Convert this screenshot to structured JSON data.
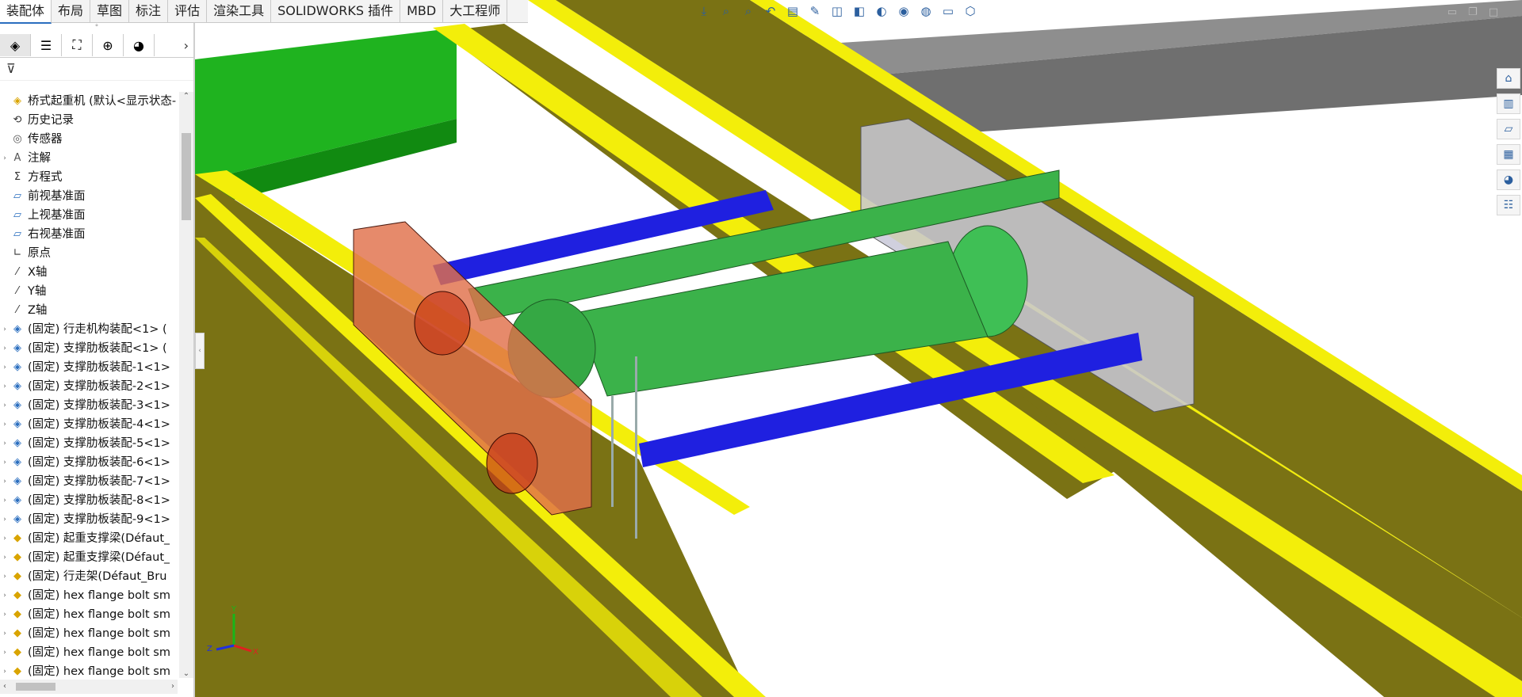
{
  "ribbon": {
    "tabs": [
      {
        "label": "装配体",
        "active": true
      },
      {
        "label": "布局"
      },
      {
        "label": "草图"
      },
      {
        "label": "标注"
      },
      {
        "label": "评估"
      },
      {
        "label": "渲染工具"
      },
      {
        "label": "SOLIDWORKS 插件"
      },
      {
        "label": "MBD"
      },
      {
        "label": "大工程师"
      }
    ]
  },
  "heads_up_toolbar": [
    "view-orientation-icon",
    "zoom-to-fit-icon",
    "zoom-area-icon",
    "previous-view-icon",
    "section-view-icon",
    "dynamic-annotation-icon",
    "view-selector-icon",
    "display-style-icon",
    "hide-show-icon",
    "appearance-icon",
    "scene-icon",
    "view-settings-icon",
    "3d-box-icon"
  ],
  "feature_manager": {
    "panel_tabs": [
      "featuremanager-icon",
      "propertymanager-icon",
      "configurationmanager-icon",
      "dimxpert-icon",
      "displaymanager-icon"
    ],
    "tree": [
      {
        "label": "桥式起重机  (默认<显示状态-",
        "icon": "assembly-root-icon",
        "expand": ""
      },
      {
        "label": "历史记录",
        "icon": "history-icon",
        "expand": ""
      },
      {
        "label": "传感器",
        "icon": "sensor-icon",
        "expand": ""
      },
      {
        "label": "注解",
        "icon": "annotation-icon",
        "expand": "›"
      },
      {
        "label": "方程式",
        "icon": "equation-icon",
        "expand": ""
      },
      {
        "label": "前视基准面",
        "icon": "plane-icon",
        "expand": ""
      },
      {
        "label": "上视基准面",
        "icon": "plane-icon",
        "expand": ""
      },
      {
        "label": "右视基准面",
        "icon": "plane-icon",
        "expand": ""
      },
      {
        "label": "原点",
        "icon": "origin-icon",
        "expand": ""
      },
      {
        "label": "X轴",
        "icon": "axis-icon",
        "expand": ""
      },
      {
        "label": "Y轴",
        "icon": "axis-icon",
        "expand": ""
      },
      {
        "label": "Z轴",
        "icon": "axis-icon",
        "expand": ""
      },
      {
        "label": "(固定) 行走机构装配<1> (",
        "icon": "subassembly-icon",
        "expand": "›"
      },
      {
        "label": "(固定) 支撑肋板装配<1> (",
        "icon": "subassembly-icon",
        "expand": "›"
      },
      {
        "label": "(固定) 支撑肋板装配-1<1>",
        "icon": "subassembly-icon",
        "expand": "›"
      },
      {
        "label": "(固定) 支撑肋板装配-2<1>",
        "icon": "subassembly-icon",
        "expand": "›"
      },
      {
        "label": "(固定) 支撑肋板装配-3<1>",
        "icon": "subassembly-icon",
        "expand": "›"
      },
      {
        "label": "(固定) 支撑肋板装配-4<1>",
        "icon": "subassembly-icon",
        "expand": "›"
      },
      {
        "label": "(固定) 支撑肋板装配-5<1>",
        "icon": "subassembly-icon",
        "expand": "›"
      },
      {
        "label": "(固定) 支撑肋板装配-6<1>",
        "icon": "subassembly-icon",
        "expand": "›"
      },
      {
        "label": "(固定) 支撑肋板装配-7<1>",
        "icon": "subassembly-icon",
        "expand": "›"
      },
      {
        "label": "(固定) 支撑肋板装配-8<1>",
        "icon": "subassembly-icon",
        "expand": "›"
      },
      {
        "label": "(固定) 支撑肋板装配-9<1>",
        "icon": "subassembly-icon",
        "expand": "›"
      },
      {
        "label": "(固定) 起重支撑梁(Défaut_",
        "icon": "part-icon",
        "expand": "›"
      },
      {
        "label": "(固定) 起重支撑梁(Défaut_",
        "icon": "part-icon",
        "expand": "›"
      },
      {
        "label": "(固定) 行走架(Défaut_Bru",
        "icon": "part-icon",
        "expand": "›"
      },
      {
        "label": "(固定) hex flange bolt sm",
        "icon": "part-icon",
        "expand": "›"
      },
      {
        "label": "(固定) hex flange bolt sm",
        "icon": "part-icon",
        "expand": "›"
      },
      {
        "label": "(固定) hex flange bolt sm",
        "icon": "part-icon",
        "expand": "›"
      },
      {
        "label": "(固定) hex flange bolt sm",
        "icon": "part-icon",
        "expand": "›"
      },
      {
        "label": "(固定) hex flange bolt sm",
        "icon": "part-icon",
        "expand": "›"
      }
    ]
  },
  "task_pane": [
    "home-icon",
    "design-library-icon",
    "file-explorer-icon",
    "view-palette-icon",
    "appearances-icon",
    "custom-properties-icon"
  ],
  "triad": {
    "x": "X",
    "y": "Y",
    "z": "Z"
  },
  "colors": {
    "accent": "#2a6ebf",
    "yellow_beam": "#f3ee0a",
    "olive_web": "#7a7214",
    "hoist_green": "#3bb24a",
    "blue_shaft": "#1f20e0",
    "red_end_carriage": "#d9572a",
    "grey_beam": "#8c8c8c"
  }
}
